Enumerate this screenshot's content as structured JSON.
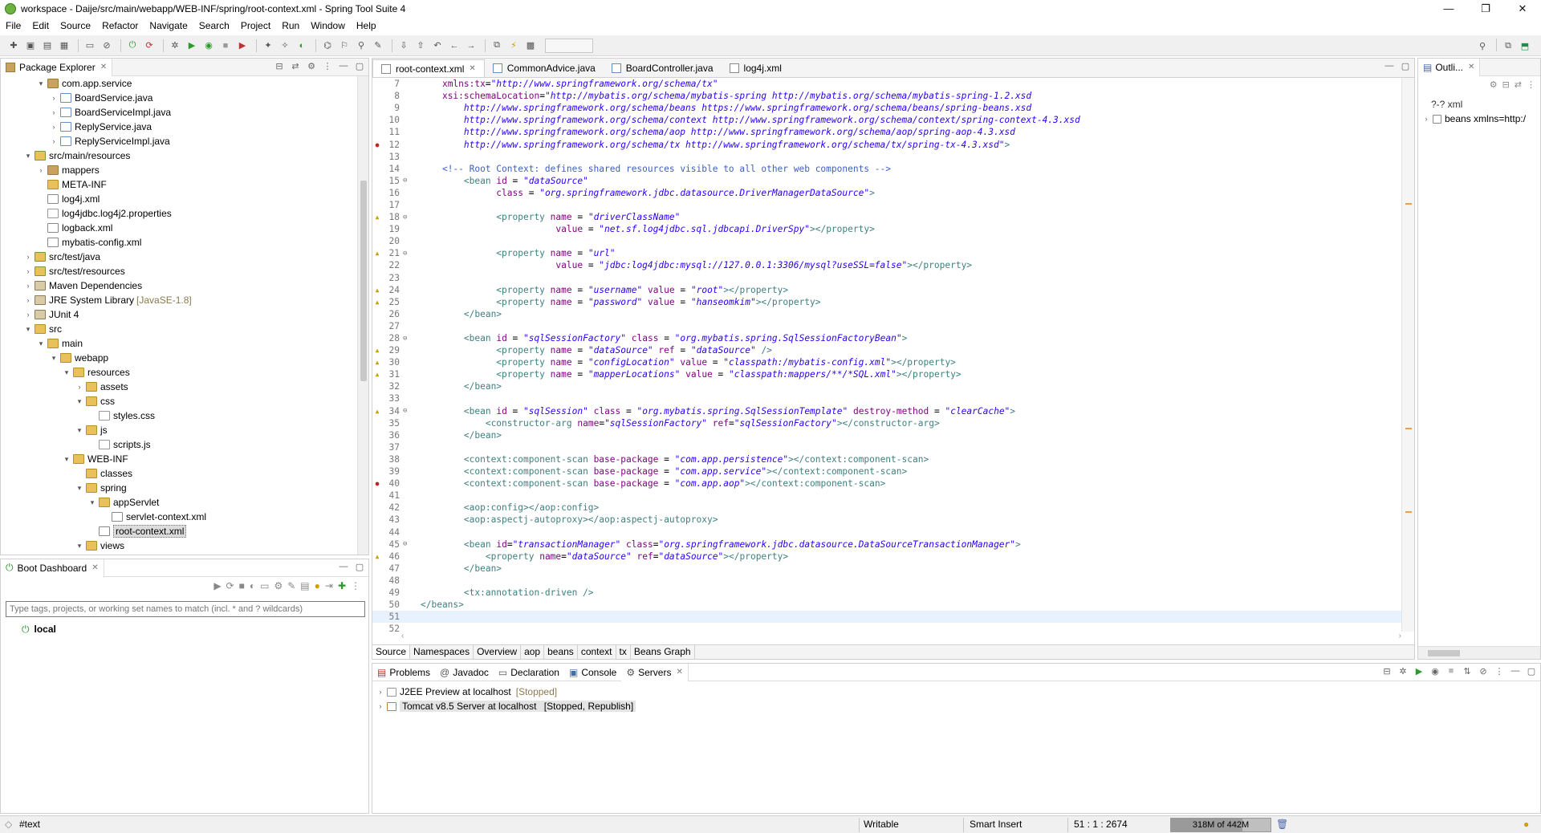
{
  "window": {
    "title": "workspace - Daije/src/main/webapp/WEB-INF/spring/root-context.xml - Spring Tool Suite 4",
    "controls": [
      "—",
      "❐",
      "✕"
    ]
  },
  "menu": [
    "File",
    "Edit",
    "Source",
    "Refactor",
    "Navigate",
    "Search",
    "Project",
    "Run",
    "Window",
    "Help"
  ],
  "package_explorer": {
    "tab_label": "Package Explorer",
    "items": [
      {
        "label": "com.app.service",
        "icon": "package-icon",
        "depth": 2,
        "twisty": "▾"
      },
      {
        "label": "BoardService.java",
        "icon": "java-file-icon",
        "depth": 3,
        "twisty": "›"
      },
      {
        "label": "BoardServiceImpl.java",
        "icon": "java-file-icon",
        "depth": 3,
        "twisty": "›"
      },
      {
        "label": "ReplyService.java",
        "icon": "java-file-icon",
        "depth": 3,
        "twisty": "›"
      },
      {
        "label": "ReplyServiceImpl.java",
        "icon": "java-file-icon",
        "depth": 3,
        "twisty": "›"
      },
      {
        "label": "src/main/resources",
        "icon": "source-folder-icon",
        "depth": 1,
        "twisty": "▾"
      },
      {
        "label": "mappers",
        "icon": "package-icon",
        "depth": 2,
        "twisty": "›"
      },
      {
        "label": "META-INF",
        "icon": "folder-icon",
        "depth": 2,
        "twisty": ""
      },
      {
        "label": "log4j.xml",
        "icon": "xml-file-icon",
        "depth": 2,
        "twisty": ""
      },
      {
        "label": "log4jdbc.log4j2.properties",
        "icon": "file-icon",
        "depth": 2,
        "twisty": ""
      },
      {
        "label": "logback.xml",
        "icon": "xml-file-icon",
        "depth": 2,
        "twisty": ""
      },
      {
        "label": "mybatis-config.xml",
        "icon": "xml-file-icon",
        "depth": 2,
        "twisty": ""
      },
      {
        "label": "src/test/java",
        "icon": "source-folder-icon",
        "depth": 1,
        "twisty": "›"
      },
      {
        "label": "src/test/resources",
        "icon": "source-folder-icon",
        "depth": 1,
        "twisty": "›"
      },
      {
        "label": "Maven Dependencies",
        "icon": "library-icon",
        "depth": 1,
        "twisty": "›"
      },
      {
        "label": "JRE System Library",
        "decor": "[JavaSE-1.8]",
        "icon": "library-icon",
        "depth": 1,
        "twisty": "›"
      },
      {
        "label": "JUnit 4",
        "icon": "library-icon",
        "depth": 1,
        "twisty": "›"
      },
      {
        "label": "src",
        "icon": "folder-icon",
        "depth": 1,
        "twisty": "▾"
      },
      {
        "label": "main",
        "icon": "folder-icon",
        "depth": 2,
        "twisty": "▾"
      },
      {
        "label": "webapp",
        "icon": "folder-icon",
        "depth": 3,
        "twisty": "▾"
      },
      {
        "label": "resources",
        "icon": "folder-icon",
        "depth": 4,
        "twisty": "▾"
      },
      {
        "label": "assets",
        "icon": "folder-icon",
        "depth": 5,
        "twisty": "›"
      },
      {
        "label": "css",
        "icon": "folder-icon",
        "depth": 5,
        "twisty": "▾"
      },
      {
        "label": "styles.css",
        "icon": "file-icon",
        "depth": 6,
        "twisty": ""
      },
      {
        "label": "js",
        "icon": "folder-icon",
        "depth": 5,
        "twisty": "▾"
      },
      {
        "label": "scripts.js",
        "icon": "file-icon",
        "depth": 6,
        "twisty": ""
      },
      {
        "label": "WEB-INF",
        "icon": "folder-icon",
        "depth": 4,
        "twisty": "▾"
      },
      {
        "label": "classes",
        "icon": "folder-icon",
        "depth": 5,
        "twisty": ""
      },
      {
        "label": "spring",
        "icon": "folder-icon",
        "depth": 5,
        "twisty": "▾"
      },
      {
        "label": "appServlet",
        "icon": "folder-icon",
        "depth": 6,
        "twisty": "▾"
      },
      {
        "label": "servlet-context.xml",
        "icon": "xml-file-icon",
        "depth": 7,
        "twisty": ""
      },
      {
        "label": "root-context.xml",
        "icon": "xml-file-icon",
        "depth": 6,
        "twisty": "",
        "selected": true
      },
      {
        "label": "views",
        "icon": "folder-icon",
        "depth": 5,
        "twisty": "▾"
      }
    ]
  },
  "boot_dashboard": {
    "tab_label": "Boot Dashboard",
    "filter_placeholder": "Type tags, projects, or working set names to match (incl. * and ? wildcards)",
    "items": [
      {
        "label": "local"
      }
    ]
  },
  "editor": {
    "tabs": [
      {
        "label": "root-context.xml",
        "active": true,
        "icon": "xml-file-icon"
      },
      {
        "label": "CommonAdvice.java",
        "active": false,
        "icon": "java-file-icon"
      },
      {
        "label": "BoardController.java",
        "active": false,
        "icon": "java-file-icon"
      },
      {
        "label": "log4j.xml",
        "active": false,
        "icon": "xml-file-icon"
      }
    ],
    "lines": [
      {
        "n": "7",
        "mark": "",
        "fold": "",
        "html": "    <span class=\"attr\">xmlns:tx</span>=<span class=\"val\">\"http://www.springframework.org/schema/tx\"</span>"
      },
      {
        "n": "8",
        "mark": "",
        "fold": "",
        "html": "    <span class=\"attr\">xsi:schemaLocation</span>=<span class=\"val\">\"http://mybatis.org/schema/mybatis-spring http://mybatis.org/schema/mybatis-spring-1.2.xsd</span>"
      },
      {
        "n": "9",
        "mark": "",
        "fold": "",
        "html": "<span class=\"val\">        http://www.springframework.org/schema/beans https://www.springframework.org/schema/beans/spring-beans.xsd</span>"
      },
      {
        "n": "10",
        "mark": "",
        "fold": "",
        "html": "<span class=\"val\">        http://www.springframework.org/schema/context http://www.springframework.org/schema/context/spring-context-4.3.xsd</span>"
      },
      {
        "n": "11",
        "mark": "",
        "fold": "",
        "html": "<span class=\"val\">        http://www.springframework.org/schema/aop http://www.springframework.org/schema/aop/spring-aop-4.3.xsd</span>"
      },
      {
        "n": "12",
        "mark": "err",
        "fold": "",
        "html": "<span class=\"val\">        http://www.springframework.org/schema/tx http://www.springframework.org/schema/tx/spring-tx-4.3.xsd\"</span><span class=\"tag\">&gt;</span>"
      },
      {
        "n": "13",
        "mark": "",
        "fold": "",
        "html": ""
      },
      {
        "n": "14",
        "mark": "",
        "fold": "",
        "html": "    <span class=\"cmt\">&lt;!-- Root Context: defines shared resources visible to all other web components --&gt;</span>"
      },
      {
        "n": "15",
        "mark": "",
        "fold": "⊖",
        "html": "        <span class=\"tag\">&lt;bean</span> <span class=\"attr\">id</span> = <span class=\"val\">\"dataSource\"</span>"
      },
      {
        "n": "16",
        "mark": "",
        "fold": "",
        "html": "              <span class=\"attr\">class</span> = <span class=\"val\">\"org.springframework.jdbc.datasource.DriverManagerDataSource\"</span><span class=\"tag\">&gt;</span>"
      },
      {
        "n": "17",
        "mark": "",
        "fold": "",
        "html": ""
      },
      {
        "n": "18",
        "mark": "warn",
        "fold": "⊖",
        "html": "              <span class=\"tag\">&lt;property</span> <span class=\"attr\">name</span> = <span class=\"val\">\"driverClassName\"</span>"
      },
      {
        "n": "19",
        "mark": "",
        "fold": "",
        "html": "                         <span class=\"attr\">value</span> = <span class=\"val\">\"net.sf.log4jdbc.sql.jdbcapi.DriverSpy\"</span><span class=\"tag\">&gt;&lt;/property&gt;</span>"
      },
      {
        "n": "20",
        "mark": "",
        "fold": "",
        "html": ""
      },
      {
        "n": "21",
        "mark": "warn",
        "fold": "⊖",
        "html": "              <span class=\"tag\">&lt;property</span> <span class=\"attr\">name</span> = <span class=\"val\">\"url\"</span>"
      },
      {
        "n": "22",
        "mark": "",
        "fold": "",
        "html": "                         <span class=\"attr\">value</span> = <span class=\"val\">\"jdbc:log4jdbc:mysql://127.0.0.1:3306/mysql?useSSL=false\"</span><span class=\"tag\">&gt;&lt;/property&gt;</span>"
      },
      {
        "n": "23",
        "mark": "",
        "fold": "",
        "html": ""
      },
      {
        "n": "24",
        "mark": "warn",
        "fold": "",
        "html": "              <span class=\"tag\">&lt;property</span> <span class=\"attr\">name</span> = <span class=\"val\">\"username\"</span> <span class=\"attr\">value</span> = <span class=\"val\">\"root\"</span><span class=\"tag\">&gt;&lt;/property&gt;</span>"
      },
      {
        "n": "25",
        "mark": "warn",
        "fold": "",
        "html": "              <span class=\"tag\">&lt;property</span> <span class=\"attr\">name</span> = <span class=\"val\">\"password\"</span> <span class=\"attr\">value</span> = <span class=\"val\">\"hanseomkim\"</span><span class=\"tag\">&gt;&lt;/property&gt;</span>"
      },
      {
        "n": "26",
        "mark": "",
        "fold": "",
        "html": "        <span class=\"tag\">&lt;/bean&gt;</span>"
      },
      {
        "n": "27",
        "mark": "",
        "fold": "",
        "html": ""
      },
      {
        "n": "28",
        "mark": "",
        "fold": "⊖",
        "html": "        <span class=\"tag\">&lt;bean</span> <span class=\"attr\">id</span> = <span class=\"val\">\"sqlSessionFactory\"</span> <span class=\"attr\">class</span> = <span class=\"val\">\"org.mybatis.spring.SqlSessionFactoryBean\"</span><span class=\"tag\">&gt;</span>"
      },
      {
        "n": "29",
        "mark": "warn",
        "fold": "",
        "html": "              <span class=\"tag\">&lt;property</span> <span class=\"attr\">name</span> = <span class=\"val\">\"dataSource\"</span> <span class=\"attr\">ref</span> = <span class=\"val\">\"dataSource\"</span> <span class=\"tag\">/&gt;</span>"
      },
      {
        "n": "30",
        "mark": "warn",
        "fold": "",
        "html": "              <span class=\"tag\">&lt;property</span> <span class=\"attr\">name</span> = <span class=\"val\">\"configLocation\"</span> <span class=\"attr\">value</span> = <span class=\"val\">\"classpath:/mybatis-config.xml\"</span><span class=\"tag\">&gt;&lt;/property&gt;</span>"
      },
      {
        "n": "31",
        "mark": "warn",
        "fold": "",
        "html": "              <span class=\"tag\">&lt;property</span> <span class=\"attr\">name</span> = <span class=\"val\">\"mapperLocations\"</span> <span class=\"attr\">value</span> = <span class=\"val\">\"classpath:mappers/**/*SQL.xml\"</span><span class=\"tag\">&gt;&lt;/property&gt;</span>"
      },
      {
        "n": "32",
        "mark": "",
        "fold": "",
        "html": "        <span class=\"tag\">&lt;/bean&gt;</span>"
      },
      {
        "n": "33",
        "mark": "",
        "fold": "",
        "html": ""
      },
      {
        "n": "34",
        "mark": "warn",
        "fold": "⊖",
        "html": "        <span class=\"tag\">&lt;bean</span> <span class=\"attr\">id</span> = <span class=\"val\">\"sqlSession\"</span> <span class=\"attr\">class</span> = <span class=\"val\">\"org.mybatis.spring.SqlSessionTemplate\"</span> <span class=\"attr\">destroy-method</span> = <span class=\"val\">\"clearCache\"</span><span class=\"tag\">&gt;</span>"
      },
      {
        "n": "35",
        "mark": "",
        "fold": "",
        "html": "            <span class=\"tag\">&lt;constructor-arg</span> <span class=\"attr\">name</span>=<span class=\"val\">\"sqlSessionFactory\"</span> <span class=\"attr\">ref</span>=<span class=\"val\">\"sqlSessionFactory\"</span><span class=\"tag\">&gt;&lt;/constructor-arg&gt;</span>"
      },
      {
        "n": "36",
        "mark": "",
        "fold": "",
        "html": "        <span class=\"tag\">&lt;/bean&gt;</span>"
      },
      {
        "n": "37",
        "mark": "",
        "fold": "",
        "html": ""
      },
      {
        "n": "38",
        "mark": "",
        "fold": "",
        "html": "        <span class=\"tag\">&lt;context:component-scan</span> <span class=\"attr\">base-package</span> = <span class=\"val\">\"com.app.persistence\"</span><span class=\"tag\">&gt;&lt;/context:component-scan&gt;</span>"
      },
      {
        "n": "39",
        "mark": "",
        "fold": "",
        "html": "        <span class=\"tag\">&lt;context:component-scan</span> <span class=\"attr\">base-package</span> = <span class=\"val\">\"com.app.service\"</span><span class=\"tag\">&gt;&lt;/context:component-scan&gt;</span>"
      },
      {
        "n": "40",
        "mark": "err",
        "fold": "",
        "html": "        <span class=\"tag\">&lt;context:component-scan</span> <span class=\"attr\">base-package</span> = <span class=\"val\">\"com.app.aop\"</span><span class=\"tag\">&gt;&lt;/context:component-scan&gt;</span>"
      },
      {
        "n": "41",
        "mark": "",
        "fold": "",
        "html": ""
      },
      {
        "n": "42",
        "mark": "",
        "fold": "",
        "html": "        <span class=\"tag\">&lt;aop:config&gt;&lt;/aop:config&gt;</span>"
      },
      {
        "n": "43",
        "mark": "",
        "fold": "",
        "html": "        <span class=\"tag\">&lt;aop:aspectj-autoproxy&gt;&lt;/aop:aspectj-autoproxy&gt;</span>"
      },
      {
        "n": "44",
        "mark": "",
        "fold": "",
        "html": ""
      },
      {
        "n": "45",
        "mark": "",
        "fold": "⊖",
        "html": "        <span class=\"tag\">&lt;bean</span> <span class=\"attr\">id</span>=<span class=\"val\">\"transactionManager\"</span> <span class=\"attr\">class</span>=<span class=\"val\">\"org.springframework.jdbc.datasource.DataSourceTransactionManager\"</span><span class=\"tag\">&gt;</span>"
      },
      {
        "n": "46",
        "mark": "warn",
        "fold": "",
        "html": "            <span class=\"tag\">&lt;property</span> <span class=\"attr\">name</span>=<span class=\"val\">\"dataSource\"</span> <span class=\"attr\">ref</span>=<span class=\"val\">\"dataSource\"</span><span class=\"tag\">&gt;&lt;/property&gt;</span>"
      },
      {
        "n": "47",
        "mark": "",
        "fold": "",
        "html": "        <span class=\"tag\">&lt;/bean&gt;</span>"
      },
      {
        "n": "48",
        "mark": "",
        "fold": "",
        "html": ""
      },
      {
        "n": "49",
        "mark": "",
        "fold": "",
        "html": "        <span class=\"tag\">&lt;tx:annotation-driven /&gt;</span>"
      },
      {
        "n": "50",
        "mark": "",
        "fold": "",
        "html": "<span class=\"tag\">&lt;/beans&gt;</span>"
      },
      {
        "n": "51",
        "mark": "",
        "fold": "",
        "html": "",
        "current": true
      },
      {
        "n": "52",
        "mark": "",
        "fold": "",
        "html": ""
      }
    ],
    "bottom_tabs": [
      "Source",
      "Namespaces",
      "Overview",
      "aop",
      "beans",
      "context",
      "tx",
      "Beans Graph"
    ]
  },
  "outline": {
    "tab_label": "Outli...",
    "items": [
      {
        "label": "?-? xml",
        "twisty": ""
      },
      {
        "label": "beans xmlns=http:/",
        "twisty": "›"
      }
    ]
  },
  "console_panel": {
    "tabs": [
      {
        "label": "Problems",
        "icon": "problems-icon"
      },
      {
        "label": "Javadoc",
        "icon": "javadoc-icon"
      },
      {
        "label": "Declaration",
        "icon": "declaration-icon"
      },
      {
        "label": "Console",
        "icon": "console-icon"
      },
      {
        "label": "Servers",
        "icon": "servers-icon",
        "active": true
      }
    ],
    "servers": [
      {
        "label": "J2EE Preview at localhost",
        "status": "[Stopped]"
      },
      {
        "label": "Tomcat v8.5 Server at localhost",
        "status": "[Stopped, Republish]",
        "selected": true
      }
    ]
  },
  "status": {
    "left": "#text",
    "writable": "Writable",
    "insert_mode": "Smart Insert",
    "position": "51 : 1 : 2674",
    "heap": "318M of 442M",
    "heap_fraction": 0.72
  }
}
